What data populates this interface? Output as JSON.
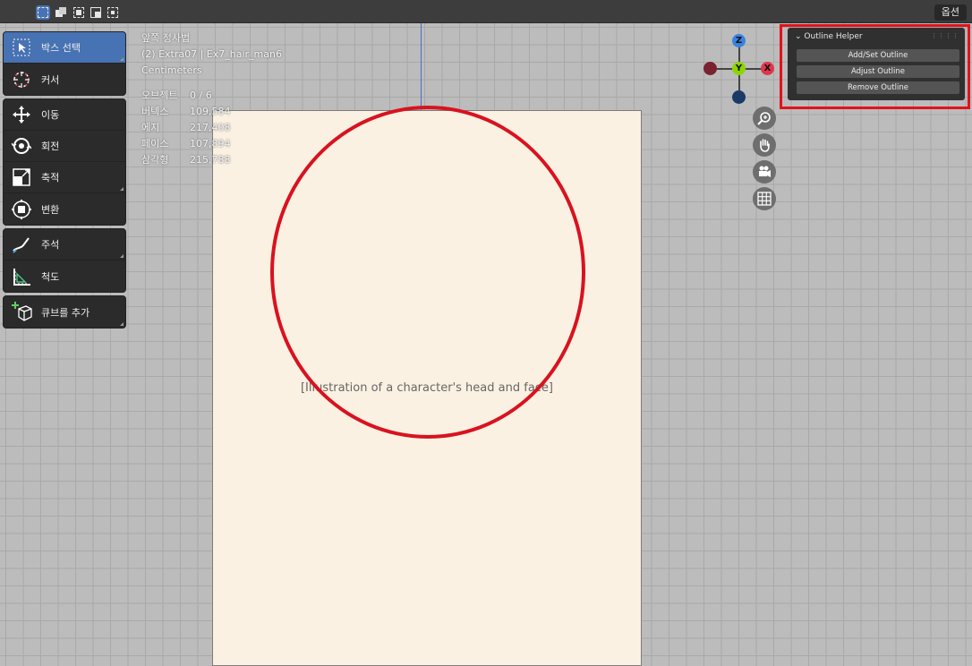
{
  "header": {
    "options_label": "옵션"
  },
  "toolbar": {
    "groups": [
      [
        {
          "label": "박스 선택",
          "icon": "cursor-select-icon",
          "active": true
        },
        {
          "label": "커서",
          "icon": "3d-cursor-icon",
          "active": false
        }
      ],
      [
        {
          "label": "이동",
          "icon": "move-icon",
          "active": false
        },
        {
          "label": "회전",
          "icon": "rotate-icon",
          "active": false
        },
        {
          "label": "축적",
          "icon": "scale-icon",
          "active": false
        },
        {
          "label": "변환",
          "icon": "transform-icon",
          "active": false
        }
      ],
      [
        {
          "label": "주석",
          "icon": "annotate-icon",
          "active": false
        },
        {
          "label": "척도",
          "icon": "measure-icon",
          "active": false
        }
      ],
      [
        {
          "label": "큐브를 추가",
          "icon": "add-cube-icon",
          "active": false
        }
      ]
    ]
  },
  "overlay": {
    "view_name": "앞쪽 정사법",
    "collection_object": "(2) Extra07 | Ex7_hair_man6",
    "units": "Centimeters",
    "stats": [
      {
        "name": "오브젝트",
        "value": "0 / 6"
      },
      {
        "name": "버텍스",
        "value": "109,584"
      },
      {
        "name": "에지",
        "value": "217,408"
      },
      {
        "name": "페이스",
        "value": "107,894"
      },
      {
        "name": "삼각형",
        "value": "215,788"
      }
    ]
  },
  "gizmo": {
    "z_label": "Z",
    "y_label": "Y",
    "x_label": "X",
    "colors": {
      "x": "#e0364c",
      "y": "#8bd600",
      "z": "#3a82e0",
      "neg": "#7a2230"
    }
  },
  "nav_buttons": [
    "zoom-icon",
    "hand-pan-icon",
    "camera-icon",
    "grid-icon"
  ],
  "npanel": {
    "title": "Outline Helper",
    "buttons": [
      "Add/Set Outline",
      "Adjust Outline",
      "Remove Outline"
    ]
  },
  "artwork": {
    "placeholder": "[Illustration of a character's head and face]"
  },
  "colors": {
    "accent": "#4772b3",
    "highlight_red": "#e3121b"
  }
}
